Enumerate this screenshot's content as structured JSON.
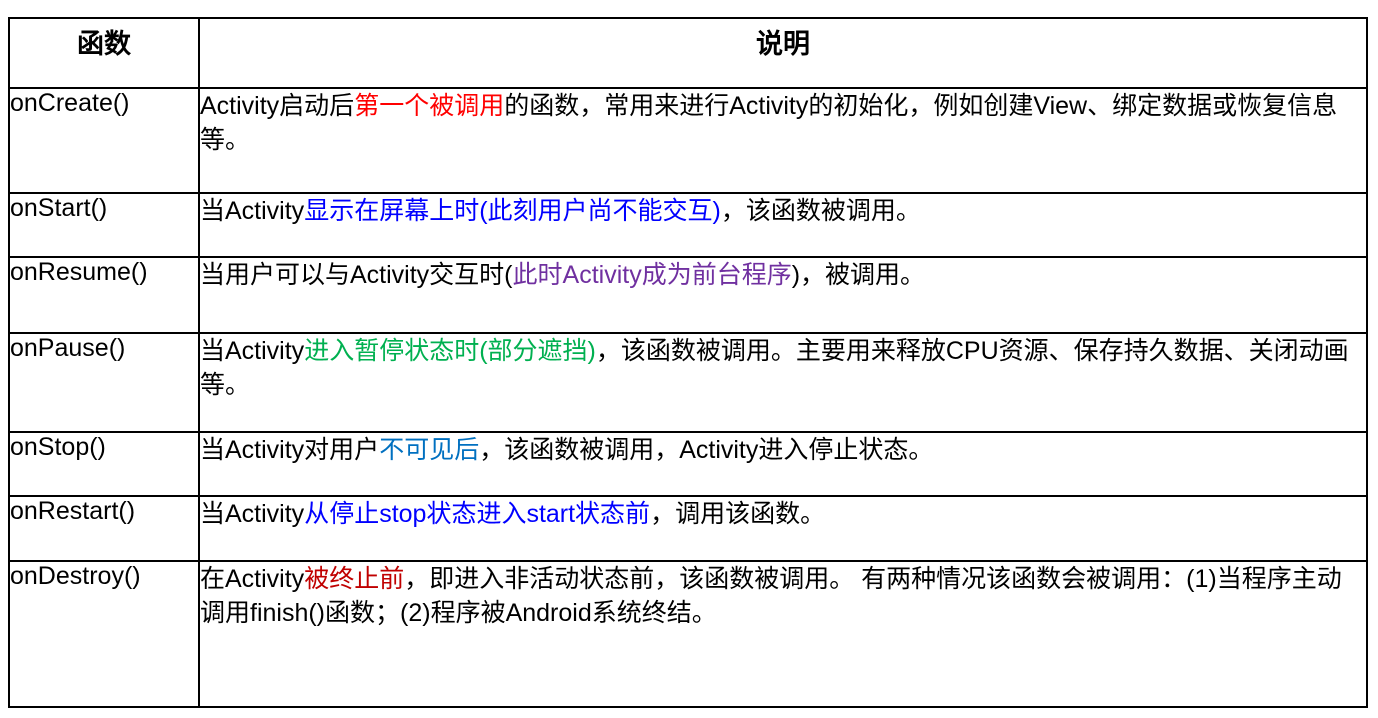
{
  "table": {
    "headers": [
      "函数",
      "说明"
    ],
    "rows": [
      {
        "fn": "onCreate()",
        "height": 105,
        "segments": [
          {
            "text": "Activity启动后",
            "color": "#000000"
          },
          {
            "text": "第一个被调用",
            "color": "#ff0000"
          },
          {
            "text": "的函数，常用来进行Activity的初始化，例如创建View、绑定数据或恢复信息等。",
            "color": "#000000"
          }
        ]
      },
      {
        "fn": "onStart()",
        "height": 64,
        "segments": [
          {
            "text": "当Activity",
            "color": "#000000"
          },
          {
            "text": "显示在屏幕上时(此刻用户尚不能交互)",
            "color": "#0000ff"
          },
          {
            "text": "，该函数被调用。",
            "color": "#000000"
          }
        ]
      },
      {
        "fn": "onResume()",
        "height": 76,
        "segments": [
          {
            "text": "当用户可以与Activity交互时(",
            "color": "#000000"
          },
          {
            "text": "此时Activity成为前台程序",
            "color": "#7030a0"
          },
          {
            "text": ")，被调用。",
            "color": "#000000"
          }
        ]
      },
      {
        "fn": "onPause()",
        "height": 99,
        "segments": [
          {
            "text": "当Activity",
            "color": "#000000"
          },
          {
            "text": "进入暂停状态时(部分遮挡)",
            "color": "#00b050"
          },
          {
            "text": "，该函数被调用。主要用来释放CPU资源、保存持久数据、关闭动画等。",
            "color": "#000000"
          }
        ]
      },
      {
        "fn": "onStop()",
        "height": 64,
        "segments": [
          {
            "text": "当Activity对用户",
            "color": "#000000"
          },
          {
            "text": "不可见后",
            "color": "#0070c0"
          },
          {
            "text": "，该函数被调用，Activity进入停止状态。",
            "color": "#000000"
          }
        ]
      },
      {
        "fn": "onRestart()",
        "height": 65,
        "segments": [
          {
            "text": "当Activity",
            "color": "#000000"
          },
          {
            "text": "从停止stop状态进入start状态前",
            "color": "#0000ff"
          },
          {
            "text": "，调用该函数。",
            "color": "#000000"
          }
        ]
      },
      {
        "fn": "onDestroy()",
        "height": 146,
        "segments": [
          {
            "text": "在Activity",
            "color": "#000000"
          },
          {
            "text": "被终止前",
            "color": "#c00000"
          },
          {
            "text": "，即进入非活动状态前，该函数被调用。 有两种情况该函数会被调用：(1)当程序主动调用finish()函数；(2)程序被Android系统终结。",
            "color": "#000000"
          }
        ]
      }
    ]
  }
}
